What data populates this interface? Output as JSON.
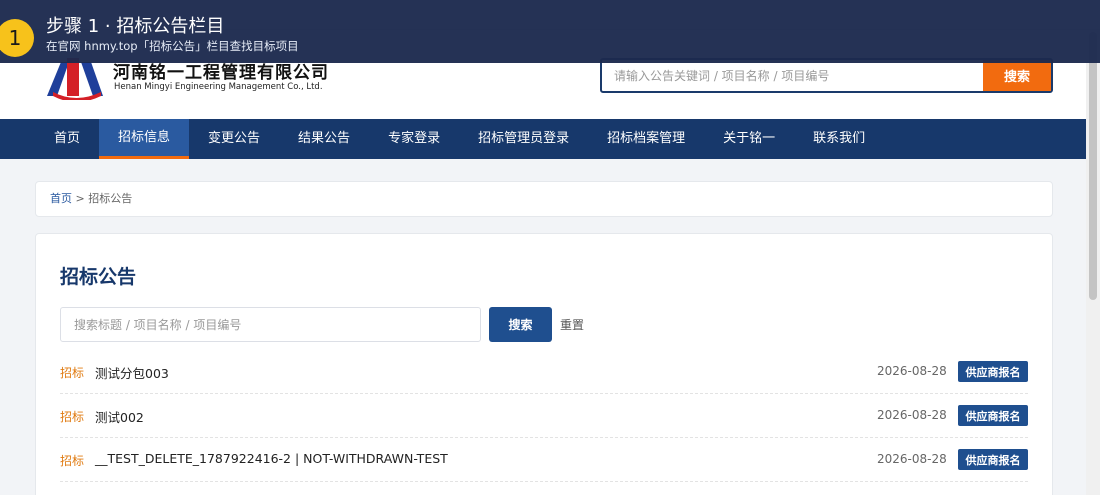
{
  "overlay": {
    "step_number": "1",
    "title": "步骤 1 · 招标公告栏目",
    "subtitle": "在官网 hnmy.top「招标公告」栏目查找目标项目"
  },
  "header": {
    "company_cn": "河南铭一工程管理有限公司",
    "company_en": "Henan Mingyi Engineering Management Co., Ltd.",
    "search_placeholder": "请输入公告关键词 / 项目名称 / 项目编号",
    "search_button": "搜索"
  },
  "nav": {
    "items": [
      {
        "label": "首页"
      },
      {
        "label": "招标信息"
      },
      {
        "label": "变更公告"
      },
      {
        "label": "结果公告"
      },
      {
        "label": "专家登录"
      },
      {
        "label": "招标管理员登录"
      },
      {
        "label": "招标档案管理"
      },
      {
        "label": "关于铭一"
      },
      {
        "label": "联系我们"
      }
    ],
    "active_index": 1
  },
  "breadcrumb": {
    "home": "首页",
    "separator": " > ",
    "current": "招标公告"
  },
  "main": {
    "title": "招标公告",
    "search_placeholder": "搜索标题 / 项目名称 / 项目编号",
    "search_button": "搜索",
    "reset_button": "重置",
    "rows": [
      {
        "tag": "招标",
        "title": "测试分包003",
        "date": "2026-08-28",
        "action": "供应商报名"
      },
      {
        "tag": "招标",
        "title": "测试002",
        "date": "2026-08-28",
        "action": "供应商报名"
      },
      {
        "tag": "招标",
        "title": "__TEST_DELETE_1787922416-2 | NOT-WITHDRAWN-TEST",
        "date": "2026-08-28",
        "action": "供应商报名"
      }
    ]
  },
  "colors": {
    "nav_bg": "#17386b",
    "accent_orange": "#f26b0f",
    "button_blue": "#1f4f8f",
    "tag_orange": "#e07b12",
    "step_badge": "#f7c21b"
  }
}
